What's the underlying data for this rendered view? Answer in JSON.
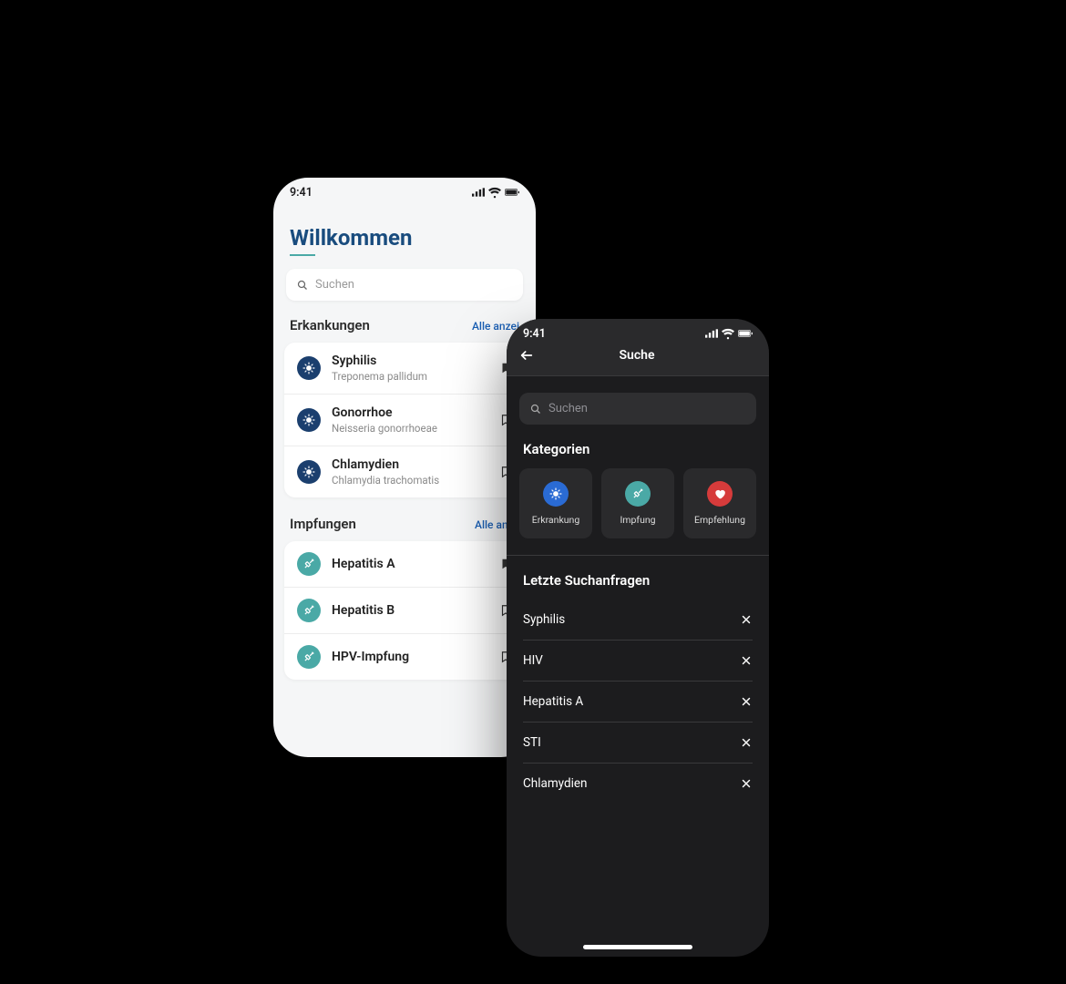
{
  "status_time": "9:41",
  "light": {
    "title": "Willkommen",
    "search_placeholder": "Suchen",
    "sections": {
      "diseases": {
        "label": "Erkankungen",
        "link": "Alle anzei"
      },
      "vaccines": {
        "label": "Impfungen",
        "link": "Alle anze"
      }
    },
    "diseases": [
      {
        "title": "Syphilis",
        "sub": "Treponema pallidum"
      },
      {
        "title": "Gonorrhoe",
        "sub": "Neisseria gonorrhoeae"
      },
      {
        "title": "Chlamydien",
        "sub": "Chlamydia trachomatis"
      }
    ],
    "vaccines": [
      {
        "title": "Hepatitis A"
      },
      {
        "title": "Hepatitis B"
      },
      {
        "title": "HPV-Impfung"
      }
    ]
  },
  "dark": {
    "nav_title": "Suche",
    "search_placeholder": "Suchen",
    "categories_label": "Kategorien",
    "categories": [
      {
        "label": "Erkrankung",
        "color": "blue",
        "icon": "disease"
      },
      {
        "label": "Impfung",
        "color": "teal",
        "icon": "vaccine"
      },
      {
        "label": "Empfehlung",
        "color": "red",
        "icon": "heart"
      }
    ],
    "recent_label": "Letzte Suchanfragen",
    "recent": [
      "Syphilis",
      "HIV",
      "Hepatitis A",
      "STI",
      "Chlamydien"
    ]
  }
}
